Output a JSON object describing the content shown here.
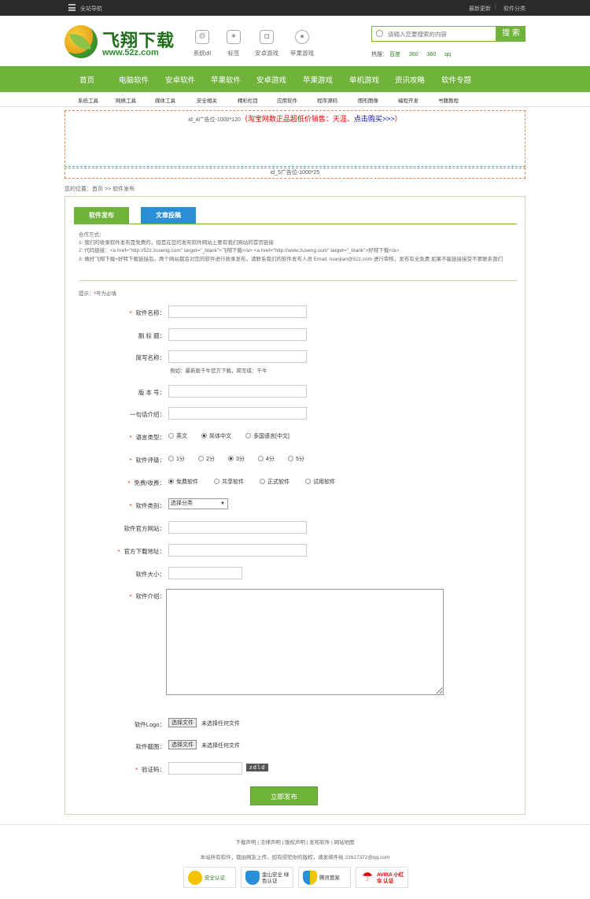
{
  "topbar": {
    "site_nav": "全站导航",
    "latest": "最新更新",
    "sep": "|",
    "categories": "软件分类"
  },
  "logo": {
    "title": "飞翔下载",
    "url": "www.52z.com"
  },
  "header_icons": [
    {
      "name": "gear",
      "label": "系统dll"
    },
    {
      "name": "badge",
      "label": "标签"
    },
    {
      "name": "android",
      "label": "安卓游戏"
    },
    {
      "name": "apple",
      "label": "苹果游戏"
    }
  ],
  "search": {
    "placeholder": "请输入您要搜索的内容",
    "button": "搜 索"
  },
  "hotwords": {
    "label": "热搜：",
    "items": [
      "百度",
      "360",
      "360",
      "qq"
    ]
  },
  "mainnav": [
    "首页",
    "电脑软件",
    "安卓软件",
    "苹果软件",
    "安卓游戏",
    "苹果游戏",
    "单机游戏",
    "资讯攻略",
    "软件专题"
  ],
  "subnav": [
    "系统工具",
    "网络工具",
    "媒体工具",
    "安全相关",
    "精彩栏目",
    "应用软件",
    "程序源码",
    "图形图像",
    "编程开发",
    "书籍教程"
  ],
  "ads": {
    "ad1_label": "id_4广告位-1000*120",
    "ad1_promo_open": "（",
    "ad1_promo_red": "淘宝网数正品超低价销售：天涯、",
    "ad1_promo_blue": "点击购买>>>",
    "ad1_promo_close": "）",
    "ad2_label": "id_5广告位-1000*25"
  },
  "breadcrumb": {
    "prefix": "您的位置：",
    "home": "首页",
    "sep": " >> ",
    "current": "软件发布"
  },
  "tabs": {
    "publish": "软件发布",
    "article": "文章投稿"
  },
  "coop": {
    "title": "合作方式：",
    "line1": "1: 我们的收录软件发布是免费的，但是在您的发布软件网站上要有我们网站的首页链接",
    "line2": "2: 代码链接：<a href=\"http://52z.zuseng.com\" target=\"_blank\">飞翔下载</a>  <a href=\"http://www.zuseng.com\" target=\"_blank\">好特下载</a>",
    "line3": "3: 做好飞翔下载+好特下载链接后，两个网站都会对您的软件进行收录发布，请联系我们的软件发布人员 Email: ruanjian@52z.com 进行审核，发布有全免费,如果不能链接接受不要联系我们"
  },
  "hint": {
    "prefix": "提示：",
    "star": "*",
    "text": "号为必填"
  },
  "form": {
    "name_label": "软件名称：",
    "subtitle_label": "副 标 题：",
    "shortname_label": "简写名称：",
    "shortname_example": "例如：最新版千牛官方下载，简写成：千牛",
    "version_label": "版 本 号：",
    "oneline_label": "一句话介绍：",
    "language_label": "语言类型：",
    "language_options": [
      "英文",
      "简体中文",
      "多国语言[中文]"
    ],
    "language_selected": "简体中文",
    "rating_label": "软件评级：",
    "rating_options": [
      "1分",
      "2分",
      "3分",
      "4分",
      "5分"
    ],
    "rating_selected": "3分",
    "license_label": "免费/收费：",
    "license_options": [
      "免费软件",
      "共享软件",
      "正式软件",
      "试用软件"
    ],
    "license_selected": "免费软件",
    "category_label": "软件类别：",
    "category_value": "选择分类",
    "website_label": "软件官方网站：",
    "download_label": "官方下载地址：",
    "size_label": "软件大小：",
    "intro_label": "软件介绍：",
    "logo_label": "软件Logo：",
    "screenshot_label": "软件截图：",
    "file_button": "选择文件",
    "file_none": "未选择任何文件",
    "captcha_label": "验证码：",
    "captcha_text": "zdld",
    "submit": "立即发布"
  },
  "footer": {
    "links": "下载声明 | 法律声明 | 版权声明 | 发布软件 | 网站地图",
    "copy": "本站所有软件，都由网友上传，如有侵犯你的版权，请发邮件给 21617372@qq.com",
    "badges": [
      "安全认证",
      "金山安全 绿色认证",
      "腾讯管家",
      "AVIRA 小红伞 认证"
    ]
  },
  "colors": {
    "green": "#6fb33b",
    "blue": "#2a8fd6",
    "red": "#ee0000",
    "dark": "#2b2b2b"
  }
}
